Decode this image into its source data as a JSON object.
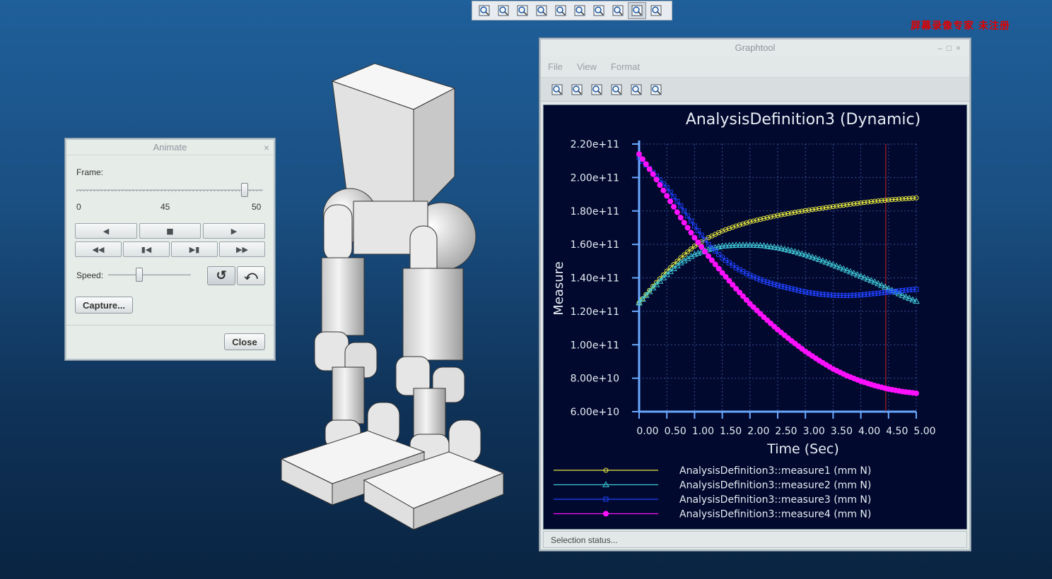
{
  "toolbar": {
    "icons": [
      "refit-icon",
      "zoom-in-icon",
      "zoom-out-icon",
      "repaint-icon",
      "view-cube-icon",
      "saved-views-icon",
      "camera-icon",
      "datum-display-icon",
      "spin-center-icon",
      "mechanism-icon"
    ]
  },
  "watermark": "屏幕录像专家 未注册",
  "animate": {
    "title": "Animate",
    "frame_label": "Frame:",
    "frame_min": "0",
    "frame_mid": "45",
    "frame_max": "50",
    "frame_value": 45,
    "speed_label": "Speed:",
    "capture_label": "Capture...",
    "close_label": "Close"
  },
  "graphtool": {
    "title": "Graphtool",
    "menu": [
      "File",
      "View",
      "Format"
    ],
    "status": "Selection status..."
  },
  "chart_data": {
    "type": "line",
    "title": "AnalysisDefinition3 (Dynamic)",
    "xlabel": "Time (Sec)",
    "ylabel": "Measure",
    "xlim": [
      0,
      5
    ],
    "ylim": [
      60000000000,
      220000000000
    ],
    "x_ticks": [
      "0.00",
      "0.50",
      "1.00",
      "1.50",
      "2.00",
      "2.50",
      "3.00",
      "3.50",
      "4.00",
      "4.50",
      "5.00"
    ],
    "y_ticks": [
      "6.00e+10",
      "8.00e+10",
      "1.00e+11",
      "1.20e+11",
      "1.40e+11",
      "1.60e+11",
      "1.80e+11",
      "2.00e+11",
      "2.20e+11"
    ],
    "grid": true,
    "legend": "bottom",
    "cursor_x": 4.45,
    "x": [
      0,
      0.25,
      0.5,
      0.75,
      1.0,
      1.25,
      1.5,
      1.75,
      2.0,
      2.25,
      2.5,
      2.75,
      3.0,
      3.25,
      3.5,
      3.75,
      4.0,
      4.25,
      4.5,
      4.75,
      5.0
    ],
    "series": [
      {
        "name": "AnalysisDefinition3::measure1 (mm N)",
        "color": "#e8e840",
        "marker": "circle",
        "values": [
          125,
          135,
          144,
          152,
          159,
          164,
          168,
          171,
          173.5,
          175.5,
          177.3,
          178.8,
          180.2,
          181.4,
          182.6,
          183.7,
          184.8,
          185.8,
          186.6,
          187.2,
          187.8
        ]
      },
      {
        "name": "AnalysisDefinition3::measure2 (mm N)",
        "color": "#40c8d8",
        "marker": "triangle",
        "values": [
          125,
          134,
          142,
          149,
          154,
          157,
          159,
          159.5,
          159.6,
          159.2,
          158,
          156.2,
          153.8,
          151,
          147.8,
          144.5,
          141,
          137.5,
          133.5,
          129.5,
          126
        ]
      },
      {
        "name": "AnalysisDefinition3::measure3 (mm N)",
        "color": "#2040ff",
        "marker": "square",
        "values": [
          212,
          203,
          194,
          183,
          171,
          160,
          152,
          146,
          141.5,
          138,
          135.5,
          133.5,
          131.5,
          130.3,
          129.6,
          129.4,
          129.8,
          130.6,
          131.5,
          132.4,
          133.2
        ]
      },
      {
        "name": "AnalysisDefinition3::measure4 (mm N)",
        "color": "#ff10ff",
        "marker": "dot",
        "values": [
          214,
          202,
          189,
          176,
          164,
          153,
          143,
          133.5,
          124.5,
          116.5,
          109,
          102.3,
          96,
          90.5,
          85.5,
          81.5,
          78.2,
          75.6,
          73.5,
          72,
          71
        ]
      }
    ],
    "y_unit_scale": 1000000000
  }
}
